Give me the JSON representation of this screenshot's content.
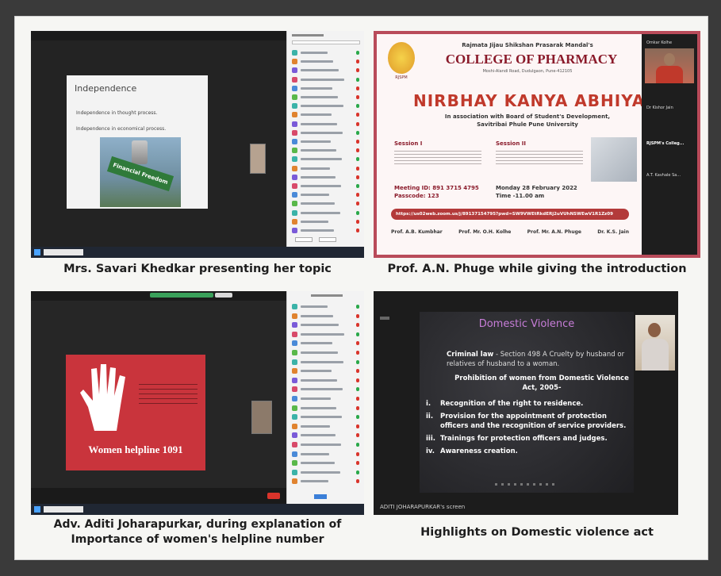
{
  "captions": {
    "tl": "Mrs. Savari Khedkar presenting her topic",
    "tr": "Prof. A.N. Phuge while giving the introduction",
    "bl_line1": "Adv. Aditi Joharapurkar, during explanation of",
    "bl_line2": "Importance of women's helpline number",
    "br": "Highlights on Domestic violence act"
  },
  "slide_tl": {
    "title": "Independence",
    "bullets": [
      "Independence in thought process.",
      "Independence in economical process."
    ],
    "sign_text": "Financial Freedom"
  },
  "poster": {
    "org": "Rajmata Jijau Shikshan Prasarak Mandal's",
    "college": "COLLEGE OF PHARMACY",
    "address": "Moshi-Alandi Road, Dudulgaon, Pune-412105",
    "logo_text": "RJSPM",
    "event": "NIRBHAY KANYA ABHIYA",
    "assoc_line1": "In association with Board of Student's Development,",
    "assoc_line2": "Savitribai Phule Pune University",
    "session1_title": "Session I",
    "session2_title": "Session II",
    "meeting_id": "Meeting ID: 891 3715 4795",
    "passcode": "Passcode: 123",
    "date": "Monday 28 February 2022",
    "time": "Time -11.00 am",
    "link": "https://us02web.zoom.us/j/89137154795?pwd=SW9VWEtRkdERj2uVUhNSWEwV1R1Zz09",
    "footer": [
      "Prof. A.B. Kumbhar",
      "Prof. Mr. O.H. Kolhe",
      "Prof. Mr. A.N. Phuge",
      "Dr. K.S. Jain"
    ],
    "side_names": [
      "Omkar Kolhe",
      "Dr Kishor Jain",
      "RJSPM's Colleg...",
      "A.T. Kavhale Sa..."
    ]
  },
  "slide_bl": {
    "helpline": "Women helpline 1091"
  },
  "slide_br": {
    "title": "Domestic Violence",
    "law_label": "Criminal law",
    "law_text": " - Section 498 A  Cruelty by husband or relatives of husband to a woman.",
    "prohib": "Prohibition of women from Domestic Violence Act, 2005-",
    "items": [
      {
        "num": "i.",
        "text": "Recognition of the right to residence."
      },
      {
        "num": "ii.",
        "text": "Provision for the appointment of protection officers and the recognition of service providers."
      },
      {
        "num": "iii.",
        "text": "Trainings for protection officers and judges."
      },
      {
        "num": "iv.",
        "text": "Awareness creation."
      }
    ],
    "screen_label": "ADITI JOHARAPURKAR's screen"
  },
  "colors": {
    "poster_border": "#b94b5a",
    "poster_title": "#c0392b",
    "poster_link_bar": "#b33a3a",
    "hand_red": "#c9343c",
    "violence_title": "#c77dd8"
  }
}
